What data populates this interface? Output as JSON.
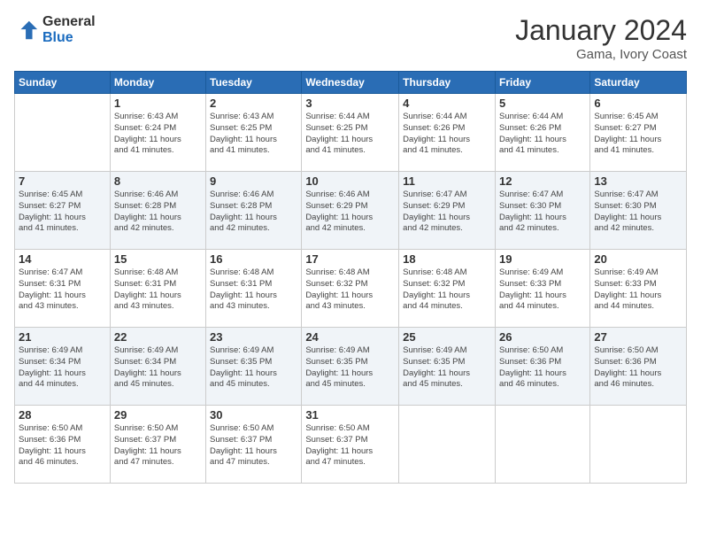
{
  "logo": {
    "general": "General",
    "blue": "Blue"
  },
  "title": "January 2024",
  "subtitle": "Gama, Ivory Coast",
  "weekdays": [
    "Sunday",
    "Monday",
    "Tuesday",
    "Wednesday",
    "Thursday",
    "Friday",
    "Saturday"
  ],
  "weeks": [
    [
      {
        "day": "",
        "info": ""
      },
      {
        "day": "1",
        "info": "Sunrise: 6:43 AM\nSunset: 6:24 PM\nDaylight: 11 hours\nand 41 minutes."
      },
      {
        "day": "2",
        "info": "Sunrise: 6:43 AM\nSunset: 6:25 PM\nDaylight: 11 hours\nand 41 minutes."
      },
      {
        "day": "3",
        "info": "Sunrise: 6:44 AM\nSunset: 6:25 PM\nDaylight: 11 hours\nand 41 minutes."
      },
      {
        "day": "4",
        "info": "Sunrise: 6:44 AM\nSunset: 6:26 PM\nDaylight: 11 hours\nand 41 minutes."
      },
      {
        "day": "5",
        "info": "Sunrise: 6:44 AM\nSunset: 6:26 PM\nDaylight: 11 hours\nand 41 minutes."
      },
      {
        "day": "6",
        "info": "Sunrise: 6:45 AM\nSunset: 6:27 PM\nDaylight: 11 hours\nand 41 minutes."
      }
    ],
    [
      {
        "day": "7",
        "info": "Sunrise: 6:45 AM\nSunset: 6:27 PM\nDaylight: 11 hours\nand 41 minutes."
      },
      {
        "day": "8",
        "info": "Sunrise: 6:46 AM\nSunset: 6:28 PM\nDaylight: 11 hours\nand 42 minutes."
      },
      {
        "day": "9",
        "info": "Sunrise: 6:46 AM\nSunset: 6:28 PM\nDaylight: 11 hours\nand 42 minutes."
      },
      {
        "day": "10",
        "info": "Sunrise: 6:46 AM\nSunset: 6:29 PM\nDaylight: 11 hours\nand 42 minutes."
      },
      {
        "day": "11",
        "info": "Sunrise: 6:47 AM\nSunset: 6:29 PM\nDaylight: 11 hours\nand 42 minutes."
      },
      {
        "day": "12",
        "info": "Sunrise: 6:47 AM\nSunset: 6:30 PM\nDaylight: 11 hours\nand 42 minutes."
      },
      {
        "day": "13",
        "info": "Sunrise: 6:47 AM\nSunset: 6:30 PM\nDaylight: 11 hours\nand 42 minutes."
      }
    ],
    [
      {
        "day": "14",
        "info": "Sunrise: 6:47 AM\nSunset: 6:31 PM\nDaylight: 11 hours\nand 43 minutes."
      },
      {
        "day": "15",
        "info": "Sunrise: 6:48 AM\nSunset: 6:31 PM\nDaylight: 11 hours\nand 43 minutes."
      },
      {
        "day": "16",
        "info": "Sunrise: 6:48 AM\nSunset: 6:31 PM\nDaylight: 11 hours\nand 43 minutes."
      },
      {
        "day": "17",
        "info": "Sunrise: 6:48 AM\nSunset: 6:32 PM\nDaylight: 11 hours\nand 43 minutes."
      },
      {
        "day": "18",
        "info": "Sunrise: 6:48 AM\nSunset: 6:32 PM\nDaylight: 11 hours\nand 44 minutes."
      },
      {
        "day": "19",
        "info": "Sunrise: 6:49 AM\nSunset: 6:33 PM\nDaylight: 11 hours\nand 44 minutes."
      },
      {
        "day": "20",
        "info": "Sunrise: 6:49 AM\nSunset: 6:33 PM\nDaylight: 11 hours\nand 44 minutes."
      }
    ],
    [
      {
        "day": "21",
        "info": "Sunrise: 6:49 AM\nSunset: 6:34 PM\nDaylight: 11 hours\nand 44 minutes."
      },
      {
        "day": "22",
        "info": "Sunrise: 6:49 AM\nSunset: 6:34 PM\nDaylight: 11 hours\nand 45 minutes."
      },
      {
        "day": "23",
        "info": "Sunrise: 6:49 AM\nSunset: 6:35 PM\nDaylight: 11 hours\nand 45 minutes."
      },
      {
        "day": "24",
        "info": "Sunrise: 6:49 AM\nSunset: 6:35 PM\nDaylight: 11 hours\nand 45 minutes."
      },
      {
        "day": "25",
        "info": "Sunrise: 6:49 AM\nSunset: 6:35 PM\nDaylight: 11 hours\nand 45 minutes."
      },
      {
        "day": "26",
        "info": "Sunrise: 6:50 AM\nSunset: 6:36 PM\nDaylight: 11 hours\nand 46 minutes."
      },
      {
        "day": "27",
        "info": "Sunrise: 6:50 AM\nSunset: 6:36 PM\nDaylight: 11 hours\nand 46 minutes."
      }
    ],
    [
      {
        "day": "28",
        "info": "Sunrise: 6:50 AM\nSunset: 6:36 PM\nDaylight: 11 hours\nand 46 minutes."
      },
      {
        "day": "29",
        "info": "Sunrise: 6:50 AM\nSunset: 6:37 PM\nDaylight: 11 hours\nand 47 minutes."
      },
      {
        "day": "30",
        "info": "Sunrise: 6:50 AM\nSunset: 6:37 PM\nDaylight: 11 hours\nand 47 minutes."
      },
      {
        "day": "31",
        "info": "Sunrise: 6:50 AM\nSunset: 6:37 PM\nDaylight: 11 hours\nand 47 minutes."
      },
      {
        "day": "",
        "info": ""
      },
      {
        "day": "",
        "info": ""
      },
      {
        "day": "",
        "info": ""
      }
    ]
  ]
}
